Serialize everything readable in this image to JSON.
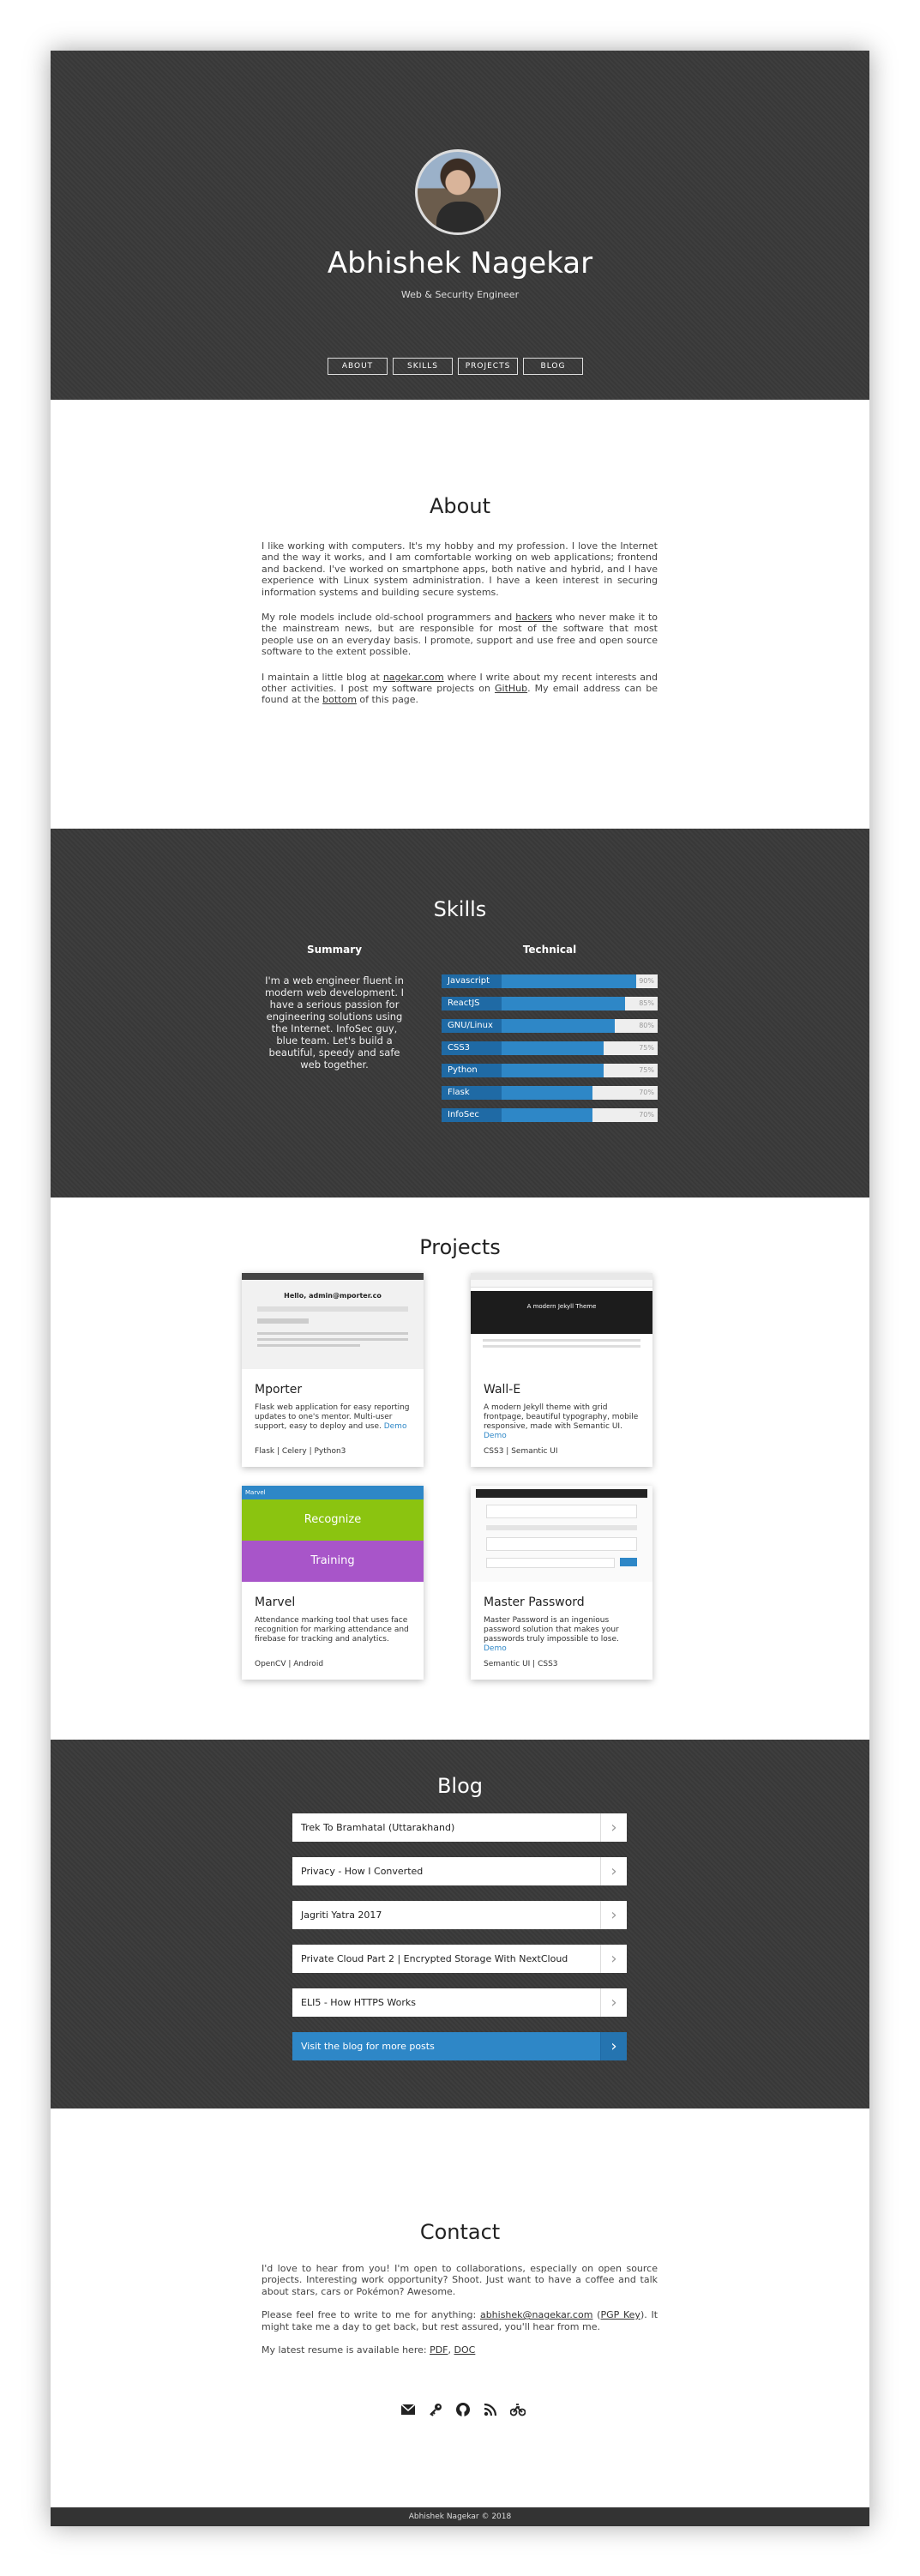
{
  "header": {
    "name": "Abhishek Nagekar",
    "subtitle": "Web & Security Engineer",
    "nav": [
      "ABOUT",
      "SKILLS",
      "PROJECTS",
      "BLOG"
    ]
  },
  "about": {
    "title": "About",
    "p1": "I like working with computers. It's my hobby and my profession. I love the Internet and the way it works, and I am comfortable working on web applications; frontend and backend. I've worked on smartphone apps, both native and hybrid, and I have experience with Linux system administration. I have a keen interest in securing information systems and building secure systems.",
    "p2_before": "My role models include old-school programmers and ",
    "p2_link": "hackers",
    "p2_after": " who never make it to the mainstream news, but are responsible for most of the software that most people use on an everyday basis. I promote, support and use free and open source software to the extent possible.",
    "p3_a": "I maintain a little blog at ",
    "p3_link1": "nagekar.com",
    "p3_b": " where I write about my recent interests and other activities. I post my software projects on ",
    "p3_link2": "GitHub",
    "p3_c": ". My email address can be found at the ",
    "p3_link3": "bottom",
    "p3_d": " of this page."
  },
  "skills": {
    "title": "Skills",
    "summary_heading": "Summary",
    "technical_heading": "Technical",
    "summary": "I'm a web engineer fluent in modern web development. I have a serious passion for engineering solutions using the Internet. InfoSec guy, blue team. Let's build a beautiful, speedy and safe web together.",
    "items": [
      {
        "name": "Javascript",
        "pct": "90%",
        "level": 90
      },
      {
        "name": "ReactJS",
        "pct": "85%",
        "level": 85
      },
      {
        "name": "GNU/Linux",
        "pct": "80%",
        "level": 80
      },
      {
        "name": "CSS3",
        "pct": "75%",
        "level": 75
      },
      {
        "name": "Python",
        "pct": "75%",
        "level": 75
      },
      {
        "name": "Flask",
        "pct": "70%",
        "level": 70
      },
      {
        "name": "InfoSec",
        "pct": "70%",
        "level": 70
      }
    ]
  },
  "projects": {
    "title": "Projects",
    "cards": [
      {
        "title": "Mporter",
        "desc": "Flask web application for easy reporting updates to one's mentor. Multi-user support, easy to deploy and use.",
        "demo": "Demo",
        "tags": "Flask | Celery | Python3",
        "shot_heading": "Hello, admin@mporter.co"
      },
      {
        "title": "Wall-E",
        "desc": "A modern Jekyll theme with grid frontpage, beautiful typography, mobile responsive, made with Semantic UI.",
        "demo": "Demo",
        "tags": "CSS3 | Semantic UI",
        "shot_heading": "A modern Jekyll Theme"
      },
      {
        "title": "Marvel",
        "desc": "Attendance marking tool that uses face recognition for marking attendance and firebase for tracking and analytics.",
        "demo": "",
        "tags": "OpenCV | Android",
        "shot_top": "Marvel",
        "shot_btn1": "Recognize",
        "shot_btn2": "Training"
      },
      {
        "title": "Master Password",
        "desc": "Master Password is an ingenious password solution that makes your passwords truly impossible to lose.",
        "demo": "Demo",
        "tags": "Semantic UI | CSS3"
      }
    ]
  },
  "blog": {
    "title": "Blog",
    "posts": [
      "Trek To Bramhatal (Uttarakhand)",
      "Privacy - How I Converted",
      "Jagriti Yatra 2017",
      "Private Cloud Part 2 | Encrypted Storage With NextCloud",
      "ELI5 - How HTTPS Works"
    ],
    "more": "Visit the blog for more posts"
  },
  "contact": {
    "title": "Contact",
    "p1": "I'd love to hear from you! I'm open to collaborations, especially on open source projects. Interesting work opportunity? Shoot. Just want to have a coffee and talk about stars, cars or Pokémon? Awesome.",
    "p2_a": "Please feel free to write to me for anything: ",
    "email": "abhishek@nagekar.com",
    "p2_b": " (",
    "pgp": "PGP Key",
    "p2_c": "). It might take me a day to get back, but rest assured, you'll hear from me.",
    "p3_a": "My latest resume is available here: ",
    "pdf": "PDF",
    "sep": ", ",
    "doc": "DOC",
    "icons": [
      "envelope-icon",
      "key-icon",
      "github-icon",
      "rss-icon",
      "bicycle-icon"
    ]
  },
  "footer": {
    "text": "Abhishek Nagekar © 2018"
  },
  "colors": {
    "dark": "#3a3a3a",
    "accent": "#2e87c7",
    "accent_dark": "#1f6aa5"
  }
}
